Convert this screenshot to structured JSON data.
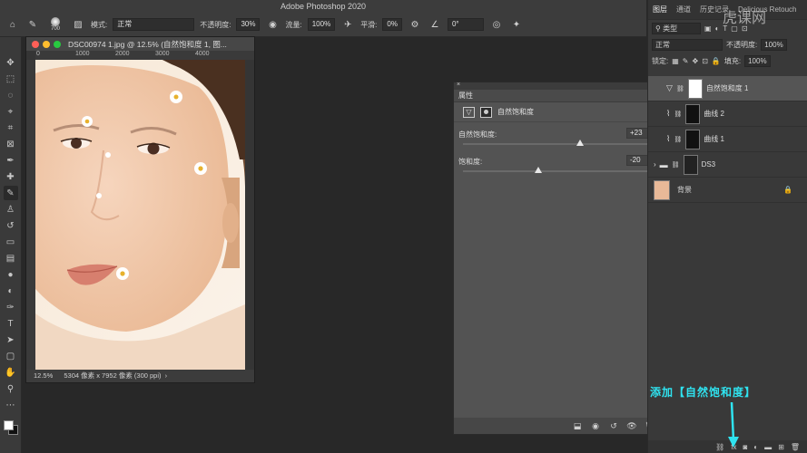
{
  "app": {
    "title": "Adobe Photoshop 2020",
    "watermark": "虎课网"
  },
  "options_bar": {
    "brush_size": "700",
    "mode_label": "模式:",
    "mode_value": "正常",
    "opacity_label": "不透明度:",
    "opacity_value": "30%",
    "flow_label": "流量:",
    "flow_value": "100%",
    "smoothing_label": "平滑:",
    "smoothing_value": "0%",
    "angle_value": "0°"
  },
  "document": {
    "title": "DSC00974 1.jpg @ 12.5% (自然饱和度 1, 图...",
    "ruler_ticks": [
      "0",
      "1000",
      "2000",
      "3000",
      "4000"
    ],
    "zoom": "12.5%",
    "info": "5304 像素 x 7952 像素 (300 ppi)",
    "info_arrow": "›"
  },
  "properties": {
    "tab": "属性",
    "title": "自然饱和度",
    "sliders": [
      {
        "label": "自然饱和度:",
        "value": "+23",
        "position": 0.62
      },
      {
        "label": "饱和度:",
        "value": "-20",
        "position": 0.4
      }
    ]
  },
  "layers_panel": {
    "tabs": [
      "图层",
      "通道",
      "历史记录",
      "Delicious Retouch"
    ],
    "kind_label": "类型",
    "blend_mode": "正常",
    "opacity_label": "不透明度:",
    "opacity_value": "100%",
    "lock_label": "锁定:",
    "fill_label": "填充:",
    "fill_value": "100%",
    "layers": [
      {
        "name": "自然饱和度 1",
        "selected": true
      },
      {
        "name": "曲线 2",
        "selected": false
      },
      {
        "name": "曲线 1",
        "selected": false
      },
      {
        "name": "DS3",
        "selected": false
      },
      {
        "name": "背景",
        "selected": false
      }
    ],
    "footer_fx": "fx"
  },
  "annotation": {
    "text": "添加【自然饱和度】",
    "color": "#2fe3f0"
  }
}
